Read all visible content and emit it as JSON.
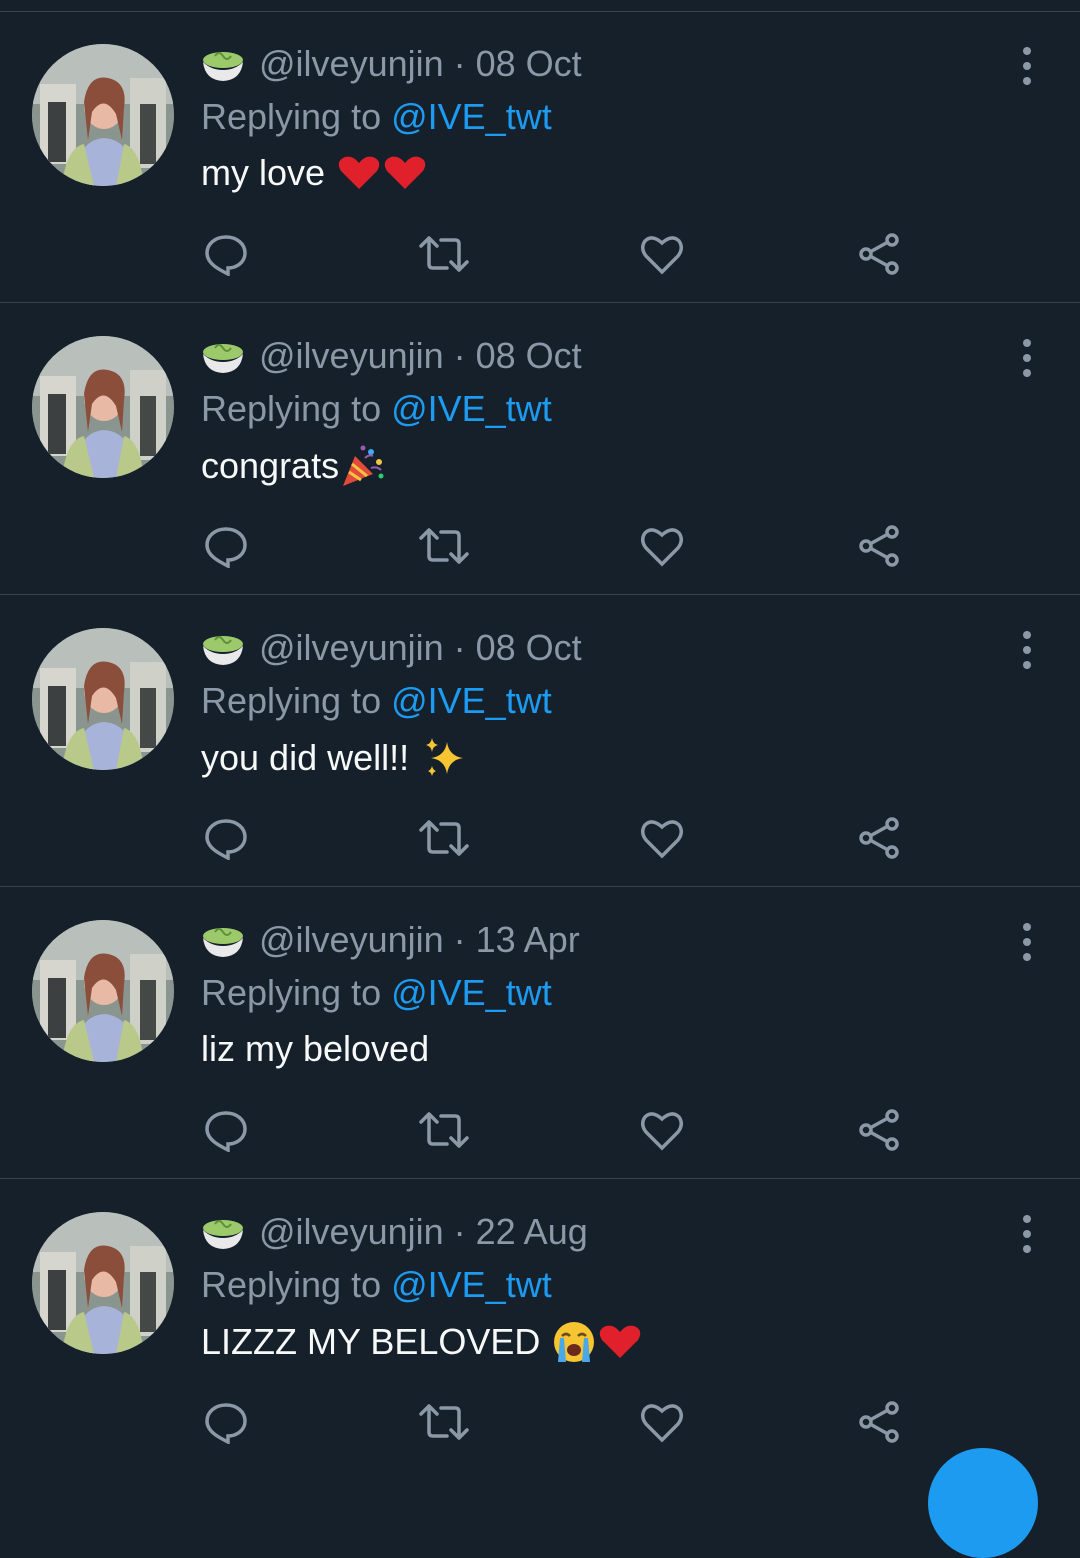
{
  "tweets": [
    {
      "handle": "@ilveyunjin",
      "dot": "·",
      "date": "08 Oct",
      "reply_prefix": "Replying to ",
      "mention": "@IVE_twt",
      "text": "my love",
      "emoji": "hearts"
    },
    {
      "handle": "@ilveyunjin",
      "dot": "·",
      "date": "08 Oct",
      "reply_prefix": "Replying to ",
      "mention": "@IVE_twt",
      "text": "congrats",
      "emoji": "party"
    },
    {
      "handle": "@ilveyunjin",
      "dot": "·",
      "date": "08 Oct",
      "reply_prefix": "Replying to ",
      "mention": "@IVE_twt",
      "text": "you did well!!",
      "emoji": "sparkles"
    },
    {
      "handle": "@ilveyunjin",
      "dot": "·",
      "date": "13 Apr",
      "reply_prefix": "Replying to ",
      "mention": "@IVE_twt",
      "text": "liz my beloved",
      "emoji": "none"
    },
    {
      "handle": "@ilveyunjin",
      "dot": "·",
      "date": "22 Aug",
      "reply_prefix": "Replying to ",
      "mention": "@IVE_twt",
      "text": "LIZZZ MY BELOVED",
      "emoji": "crying-heart"
    }
  ],
  "icons": {
    "name_emoji": "matcha-bowl-icon",
    "reply": "reply-icon",
    "retweet": "retweet-icon",
    "like": "heart-outline-icon",
    "share": "share-icon",
    "more": "more-vertical-icon"
  },
  "colors": {
    "background": "#15202b",
    "divider": "#38444d",
    "secondary_text": "#8b98a5",
    "mention": "#1d9bf0",
    "primary_text": "#f7f9f9"
  }
}
